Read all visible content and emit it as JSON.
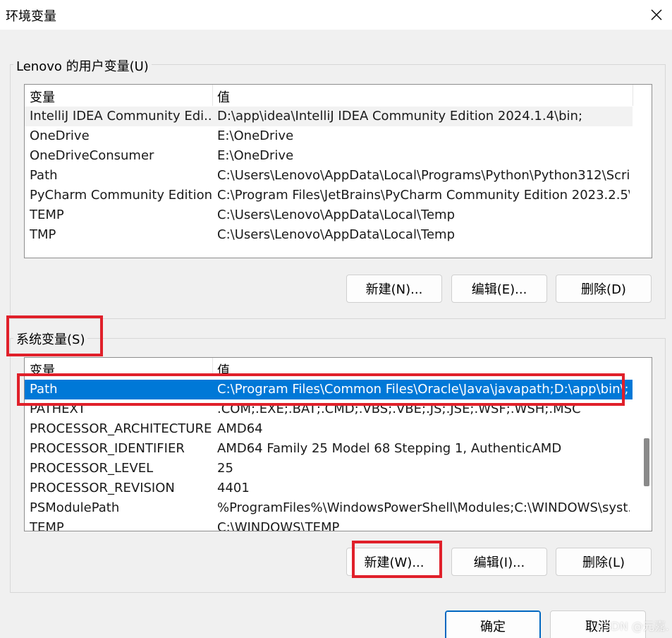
{
  "window": {
    "title": "环境变量",
    "close_icon": "close-icon"
  },
  "user_vars": {
    "group_label": "Lenovo 的用户变量(U)",
    "col_name": "变量",
    "col_value": "值",
    "rows": [
      {
        "name": "IntelliJ IDEA Community Edi...",
        "value": "D:\\app\\idea\\IntelliJ IDEA Community Edition 2024.1.4\\bin;"
      },
      {
        "name": "OneDrive",
        "value": "E:\\OneDrive"
      },
      {
        "name": "OneDriveConsumer",
        "value": "E:\\OneDrive"
      },
      {
        "name": "Path",
        "value": "C:\\Users\\Lenovo\\AppData\\Local\\Programs\\Python\\Python312\\Scri..."
      },
      {
        "name": "PyCharm Community Edition",
        "value": "C:\\Program Files\\JetBrains\\PyCharm Community Edition 2023.2.5\\..."
      },
      {
        "name": "TEMP",
        "value": "C:\\Users\\Lenovo\\AppData\\Local\\Temp"
      },
      {
        "name": "TMP",
        "value": "C:\\Users\\Lenovo\\AppData\\Local\\Temp"
      }
    ],
    "buttons": {
      "new": "新建(N)...",
      "edit": "编辑(E)...",
      "delete": "删除(D)"
    }
  },
  "system_vars": {
    "group_label": "系统变量(S)",
    "col_name": "变量",
    "col_value": "值",
    "rows": [
      {
        "name": "Path",
        "value": "C:\\Program Files\\Common Files\\Oracle\\Java\\javapath;D:\\app\\bin\\;..."
      },
      {
        "name": "PATHEXT",
        "value": ".COM;.EXE;.BAT;.CMD;.VBS;.VBE;.JS;.JSE;.WSF;.WSH;.MSC"
      },
      {
        "name": "PROCESSOR_ARCHITECTURE",
        "value": "AMD64"
      },
      {
        "name": "PROCESSOR_IDENTIFIER",
        "value": "AMD64 Family 25 Model 68 Stepping 1, AuthenticAMD"
      },
      {
        "name": "PROCESSOR_LEVEL",
        "value": "25"
      },
      {
        "name": "PROCESSOR_REVISION",
        "value": "4401"
      },
      {
        "name": "PSModulePath",
        "value": "%ProgramFiles%\\WindowsPowerShell\\Modules;C:\\WINDOWS\\syst..."
      },
      {
        "name": "TEMP",
        "value": "C:\\WINDOWS\\TEMP"
      }
    ],
    "selected_index": 0,
    "buttons": {
      "new": "新建(W)...",
      "edit": "编辑(I)...",
      "delete": "删除(L)"
    }
  },
  "footer": {
    "ok": "确定",
    "cancel": "取消"
  },
  "watermark": "CSDN @元嘉.",
  "colors": {
    "selection": "#0078d7",
    "highlight_box": "#e0202a",
    "primary_border": "#0067c0"
  }
}
